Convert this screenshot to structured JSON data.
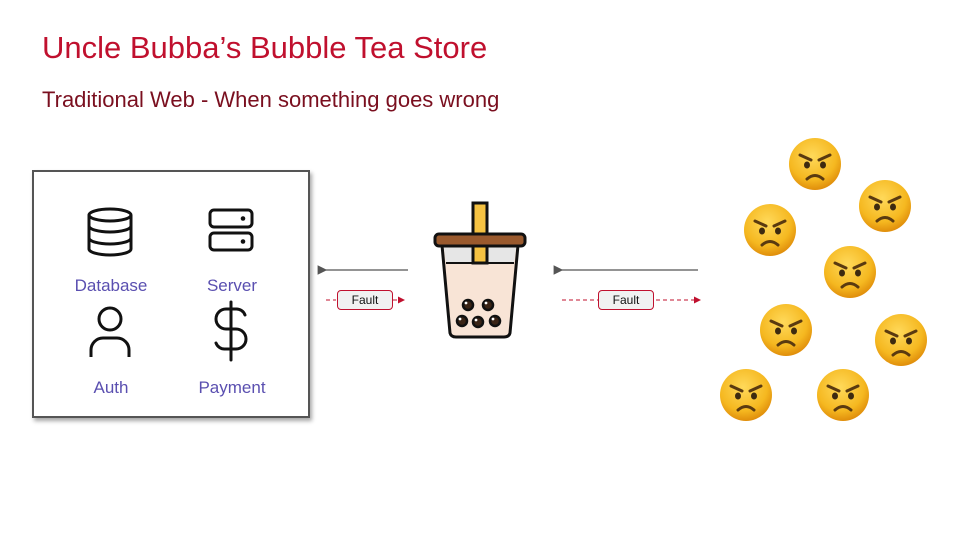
{
  "slide": {
    "title": "Uncle Bubba’s Bubble Tea Store",
    "subtitle": "Traditional Web - When something goes wrong"
  },
  "services": {
    "database": {
      "label": "Database",
      "icon": "database-icon"
    },
    "server": {
      "label": "Server",
      "icon": "server-icon"
    },
    "auth": {
      "label": "Auth",
      "icon": "user-icon"
    },
    "payment": {
      "label": "Payment",
      "icon": "dollar-icon"
    }
  },
  "flow": {
    "left_fault_label": "Fault",
    "right_fault_label": "Fault",
    "request_arrow_color": "#555555",
    "fault_arrow_color": "#c0102e"
  },
  "store_icon": "bubble-tea-cup-icon",
  "customers": {
    "icon": "angry-face-emoji",
    "count": 8
  }
}
